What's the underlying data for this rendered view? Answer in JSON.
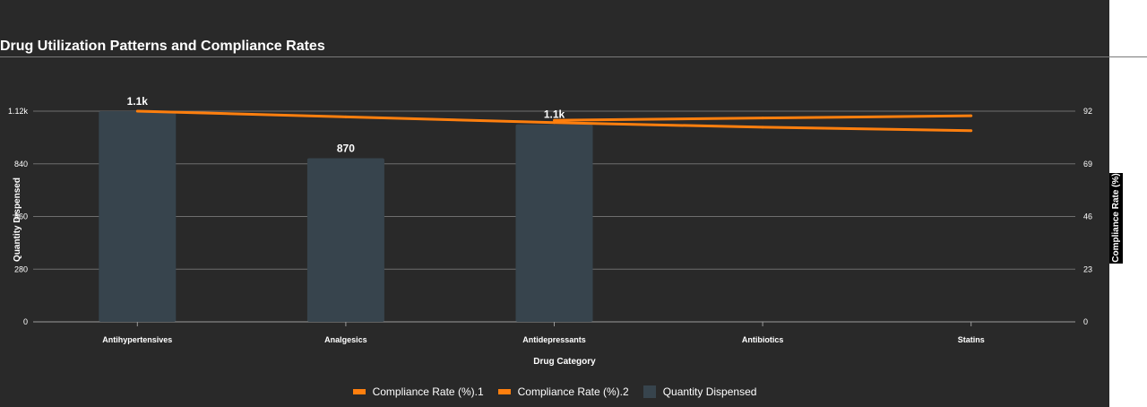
{
  "page": {
    "title": "Drug Utilization Patterns and Compliance Rates"
  },
  "chart_data": {
    "type": "bar",
    "categories": [
      "Antihypertensives",
      "Analgesics",
      "Antidepressants",
      "Antibiotics",
      "Statins"
    ],
    "xlabel": "Drug Category",
    "ylabel": "Quantity Dispensed",
    "y2label": "Compliance Rate (%)",
    "ylim": [
      0,
      1120
    ],
    "yticks": [
      "0",
      "280",
      "560",
      "840",
      "1.12k"
    ],
    "y2lim": [
      0,
      92
    ],
    "y2ticks": [
      "0",
      "23",
      "46",
      "69",
      "92"
    ],
    "grid": true,
    "legend_position": "bottom",
    "series": [
      {
        "name": "Quantity Dispensed",
        "type": "bar",
        "axis": "left",
        "color": "#37444d",
        "values": [
          1120,
          870,
          1050,
          null,
          null
        ],
        "data_labels": [
          "1.1k",
          "870",
          "1.1k",
          "",
          ""
        ]
      },
      {
        "name": "Compliance Rate (%).1",
        "type": "line",
        "axis": "right",
        "color": "#ff7f0e",
        "values": [
          92,
          89.5,
          87,
          85,
          83.5
        ]
      },
      {
        "name": "Compliance Rate (%).2",
        "type": "line",
        "axis": "right",
        "color": "#ff7f0e",
        "values": [
          null,
          null,
          88,
          89,
          90
        ]
      }
    ],
    "legend_order": [
      "Compliance Rate (%).1",
      "Compliance Rate (%).2",
      "Quantity Dispensed"
    ]
  }
}
